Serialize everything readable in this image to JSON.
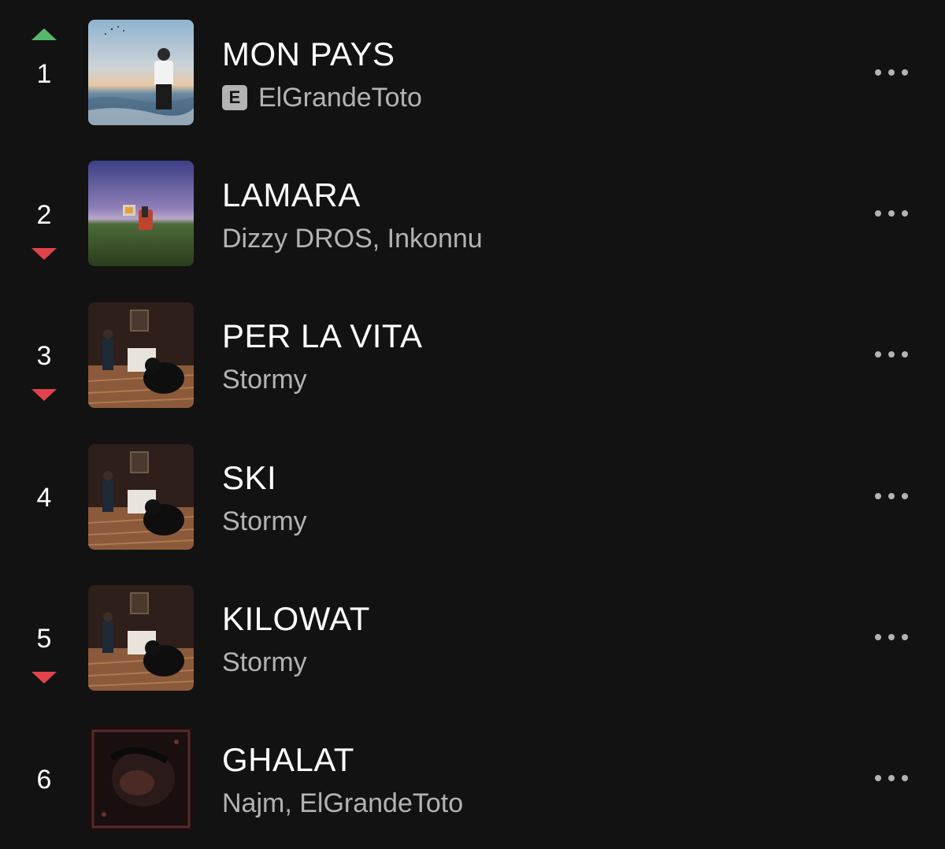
{
  "colors": {
    "background": "#121212",
    "title": "#ffffff",
    "subtitle": "#b3b3b3",
    "trend_up": "#58b96b",
    "trend_down": "#e0434b"
  },
  "tracks": [
    {
      "rank": "1",
      "trend": "up",
      "title": "MON PAYS",
      "explicit": true,
      "explicit_label": "E",
      "artists": "ElGrandeToto",
      "more_icon": "more-horizontal-icon"
    },
    {
      "rank": "2",
      "trend": "down",
      "title": "LAMARA",
      "explicit": false,
      "artists": "Dizzy DROS, Inkonnu",
      "more_icon": "more-horizontal-icon"
    },
    {
      "rank": "3",
      "trend": "down",
      "title": "PER LA VITA",
      "explicit": false,
      "artists": "Stormy",
      "more_icon": "more-horizontal-icon"
    },
    {
      "rank": "4",
      "trend": "same",
      "title": "SKI",
      "explicit": false,
      "artists": "Stormy",
      "more_icon": "more-horizontal-icon"
    },
    {
      "rank": "5",
      "trend": "down",
      "title": "KILOWAT",
      "explicit": false,
      "artists": "Stormy",
      "more_icon": "more-horizontal-icon"
    },
    {
      "rank": "6",
      "trend": "same",
      "title": "GHALAT",
      "explicit": false,
      "artists": "Najm, ElGrandeToto",
      "more_icon": "more-horizontal-icon"
    }
  ]
}
